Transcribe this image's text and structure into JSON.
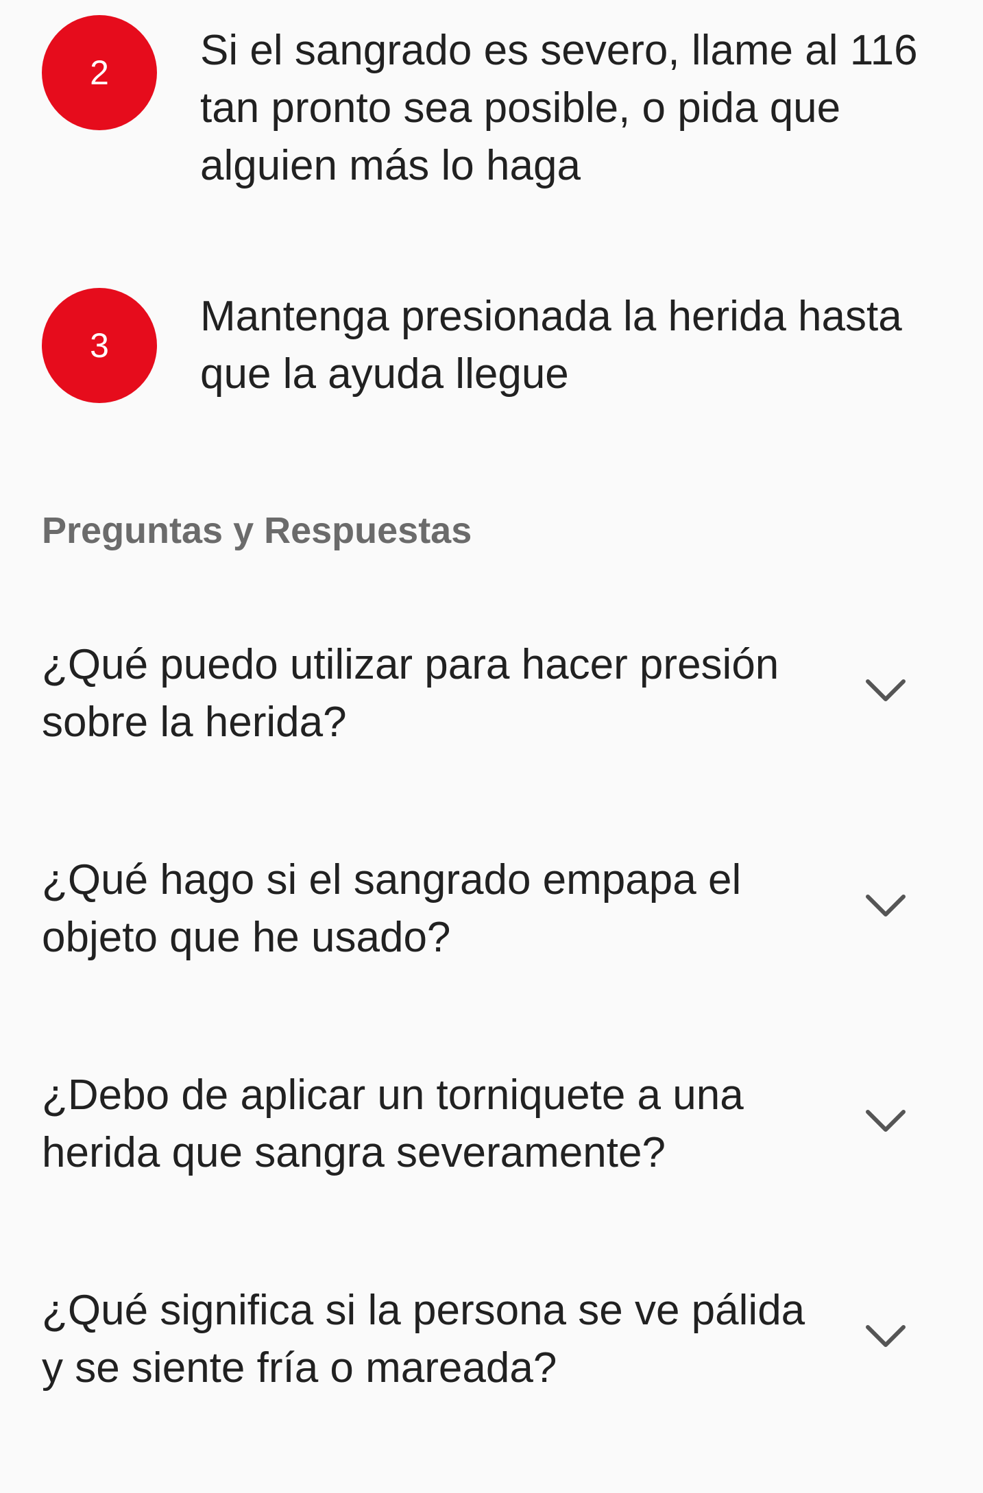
{
  "steps": [
    {
      "number": "2",
      "text": "Si el sangrado es severo, llame al 116 tan pronto sea posible, o pida que alguien más lo haga"
    },
    {
      "number": "3",
      "text": "Mantenga presionada la herida hasta que la ayuda llegue"
    }
  ],
  "faq": {
    "title": "Preguntas y Respuestas",
    "items": [
      {
        "question": "¿Qué puedo utilizar para hacer presión sobre la herida?",
        "icon": "chevron-down-icon"
      },
      {
        "question": "¿Qué hago si el sangrado empapa el objeto que he usado?",
        "icon": "chevron-down-icon"
      },
      {
        "question": "¿Debo de aplicar un torniquete a una herida que sangra severamente?",
        "icon": "chevron-down-icon"
      },
      {
        "question": "¿Qué significa si la persona se ve pálida y se siente fría o mareada?",
        "icon": "chevron-down-icon"
      }
    ]
  },
  "colors": {
    "accent": "#e60c1c",
    "background": "#fafafa",
    "text": "#212121",
    "section_title": "#6b6b6b",
    "chevron": "#555555"
  }
}
